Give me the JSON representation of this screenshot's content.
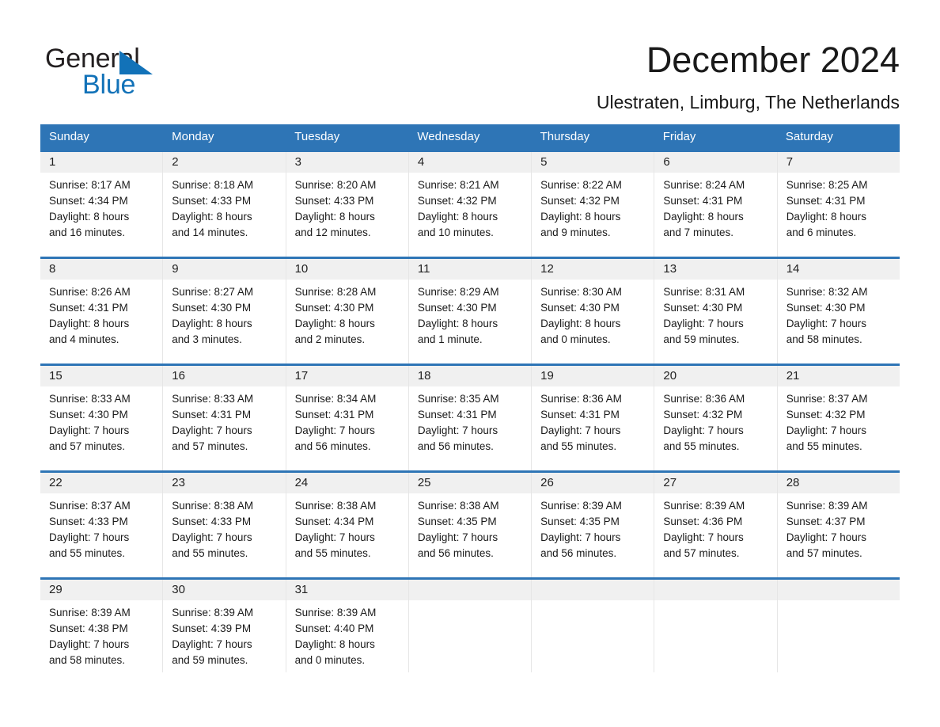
{
  "brand": {
    "line1": "General",
    "line2": "Blue",
    "triangle_color": "#1272b8"
  },
  "header": {
    "month_title": "December 2024",
    "location": "Ulestraten, Limburg, The Netherlands"
  },
  "theme": {
    "header_blue": "#2e75b6",
    "daynum_band": "#f0f0f0",
    "text": "#1a1a1a",
    "page_bg": "#ffffff"
  },
  "weekdays": [
    "Sunday",
    "Monday",
    "Tuesday",
    "Wednesday",
    "Thursday",
    "Friday",
    "Saturday"
  ],
  "weeks": [
    [
      {
        "day": "1",
        "sunrise": "Sunrise: 8:17 AM",
        "sunset": "Sunset: 4:34 PM",
        "daylight_line1": "Daylight: 8 hours",
        "daylight_line2": "and 16 minutes."
      },
      {
        "day": "2",
        "sunrise": "Sunrise: 8:18 AM",
        "sunset": "Sunset: 4:33 PM",
        "daylight_line1": "Daylight: 8 hours",
        "daylight_line2": "and 14 minutes."
      },
      {
        "day": "3",
        "sunrise": "Sunrise: 8:20 AM",
        "sunset": "Sunset: 4:33 PM",
        "daylight_line1": "Daylight: 8 hours",
        "daylight_line2": "and 12 minutes."
      },
      {
        "day": "4",
        "sunrise": "Sunrise: 8:21 AM",
        "sunset": "Sunset: 4:32 PM",
        "daylight_line1": "Daylight: 8 hours",
        "daylight_line2": "and 10 minutes."
      },
      {
        "day": "5",
        "sunrise": "Sunrise: 8:22 AM",
        "sunset": "Sunset: 4:32 PM",
        "daylight_line1": "Daylight: 8 hours",
        "daylight_line2": "and 9 minutes."
      },
      {
        "day": "6",
        "sunrise": "Sunrise: 8:24 AM",
        "sunset": "Sunset: 4:31 PM",
        "daylight_line1": "Daylight: 8 hours",
        "daylight_line2": "and 7 minutes."
      },
      {
        "day": "7",
        "sunrise": "Sunrise: 8:25 AM",
        "sunset": "Sunset: 4:31 PM",
        "daylight_line1": "Daylight: 8 hours",
        "daylight_line2": "and 6 minutes."
      }
    ],
    [
      {
        "day": "8",
        "sunrise": "Sunrise: 8:26 AM",
        "sunset": "Sunset: 4:31 PM",
        "daylight_line1": "Daylight: 8 hours",
        "daylight_line2": "and 4 minutes."
      },
      {
        "day": "9",
        "sunrise": "Sunrise: 8:27 AM",
        "sunset": "Sunset: 4:30 PM",
        "daylight_line1": "Daylight: 8 hours",
        "daylight_line2": "and 3 minutes."
      },
      {
        "day": "10",
        "sunrise": "Sunrise: 8:28 AM",
        "sunset": "Sunset: 4:30 PM",
        "daylight_line1": "Daylight: 8 hours",
        "daylight_line2": "and 2 minutes."
      },
      {
        "day": "11",
        "sunrise": "Sunrise: 8:29 AM",
        "sunset": "Sunset: 4:30 PM",
        "daylight_line1": "Daylight: 8 hours",
        "daylight_line2": "and 1 minute."
      },
      {
        "day": "12",
        "sunrise": "Sunrise: 8:30 AM",
        "sunset": "Sunset: 4:30 PM",
        "daylight_line1": "Daylight: 8 hours",
        "daylight_line2": "and 0 minutes."
      },
      {
        "day": "13",
        "sunrise": "Sunrise: 8:31 AM",
        "sunset": "Sunset: 4:30 PM",
        "daylight_line1": "Daylight: 7 hours",
        "daylight_line2": "and 59 minutes."
      },
      {
        "day": "14",
        "sunrise": "Sunrise: 8:32 AM",
        "sunset": "Sunset: 4:30 PM",
        "daylight_line1": "Daylight: 7 hours",
        "daylight_line2": "and 58 minutes."
      }
    ],
    [
      {
        "day": "15",
        "sunrise": "Sunrise: 8:33 AM",
        "sunset": "Sunset: 4:30 PM",
        "daylight_line1": "Daylight: 7 hours",
        "daylight_line2": "and 57 minutes."
      },
      {
        "day": "16",
        "sunrise": "Sunrise: 8:33 AM",
        "sunset": "Sunset: 4:31 PM",
        "daylight_line1": "Daylight: 7 hours",
        "daylight_line2": "and 57 minutes."
      },
      {
        "day": "17",
        "sunrise": "Sunrise: 8:34 AM",
        "sunset": "Sunset: 4:31 PM",
        "daylight_line1": "Daylight: 7 hours",
        "daylight_line2": "and 56 minutes."
      },
      {
        "day": "18",
        "sunrise": "Sunrise: 8:35 AM",
        "sunset": "Sunset: 4:31 PM",
        "daylight_line1": "Daylight: 7 hours",
        "daylight_line2": "and 56 minutes."
      },
      {
        "day": "19",
        "sunrise": "Sunrise: 8:36 AM",
        "sunset": "Sunset: 4:31 PM",
        "daylight_line1": "Daylight: 7 hours",
        "daylight_line2": "and 55 minutes."
      },
      {
        "day": "20",
        "sunrise": "Sunrise: 8:36 AM",
        "sunset": "Sunset: 4:32 PM",
        "daylight_line1": "Daylight: 7 hours",
        "daylight_line2": "and 55 minutes."
      },
      {
        "day": "21",
        "sunrise": "Sunrise: 8:37 AM",
        "sunset": "Sunset: 4:32 PM",
        "daylight_line1": "Daylight: 7 hours",
        "daylight_line2": "and 55 minutes."
      }
    ],
    [
      {
        "day": "22",
        "sunrise": "Sunrise: 8:37 AM",
        "sunset": "Sunset: 4:33 PM",
        "daylight_line1": "Daylight: 7 hours",
        "daylight_line2": "and 55 minutes."
      },
      {
        "day": "23",
        "sunrise": "Sunrise: 8:38 AM",
        "sunset": "Sunset: 4:33 PM",
        "daylight_line1": "Daylight: 7 hours",
        "daylight_line2": "and 55 minutes."
      },
      {
        "day": "24",
        "sunrise": "Sunrise: 8:38 AM",
        "sunset": "Sunset: 4:34 PM",
        "daylight_line1": "Daylight: 7 hours",
        "daylight_line2": "and 55 minutes."
      },
      {
        "day": "25",
        "sunrise": "Sunrise: 8:38 AM",
        "sunset": "Sunset: 4:35 PM",
        "daylight_line1": "Daylight: 7 hours",
        "daylight_line2": "and 56 minutes."
      },
      {
        "day": "26",
        "sunrise": "Sunrise: 8:39 AM",
        "sunset": "Sunset: 4:35 PM",
        "daylight_line1": "Daylight: 7 hours",
        "daylight_line2": "and 56 minutes."
      },
      {
        "day": "27",
        "sunrise": "Sunrise: 8:39 AM",
        "sunset": "Sunset: 4:36 PM",
        "daylight_line1": "Daylight: 7 hours",
        "daylight_line2": "and 57 minutes."
      },
      {
        "day": "28",
        "sunrise": "Sunrise: 8:39 AM",
        "sunset": "Sunset: 4:37 PM",
        "daylight_line1": "Daylight: 7 hours",
        "daylight_line2": "and 57 minutes."
      }
    ],
    [
      {
        "day": "29",
        "sunrise": "Sunrise: 8:39 AM",
        "sunset": "Sunset: 4:38 PM",
        "daylight_line1": "Daylight: 7 hours",
        "daylight_line2": "and 58 minutes."
      },
      {
        "day": "30",
        "sunrise": "Sunrise: 8:39 AM",
        "sunset": "Sunset: 4:39 PM",
        "daylight_line1": "Daylight: 7 hours",
        "daylight_line2": "and 59 minutes."
      },
      {
        "day": "31",
        "sunrise": "Sunrise: 8:39 AM",
        "sunset": "Sunset: 4:40 PM",
        "daylight_line1": "Daylight: 8 hours",
        "daylight_line2": "and 0 minutes."
      },
      {
        "day": "",
        "sunrise": "",
        "sunset": "",
        "daylight_line1": "",
        "daylight_line2": ""
      },
      {
        "day": "",
        "sunrise": "",
        "sunset": "",
        "daylight_line1": "",
        "daylight_line2": ""
      },
      {
        "day": "",
        "sunrise": "",
        "sunset": "",
        "daylight_line1": "",
        "daylight_line2": ""
      },
      {
        "day": "",
        "sunrise": "",
        "sunset": "",
        "daylight_line1": "",
        "daylight_line2": ""
      }
    ]
  ]
}
